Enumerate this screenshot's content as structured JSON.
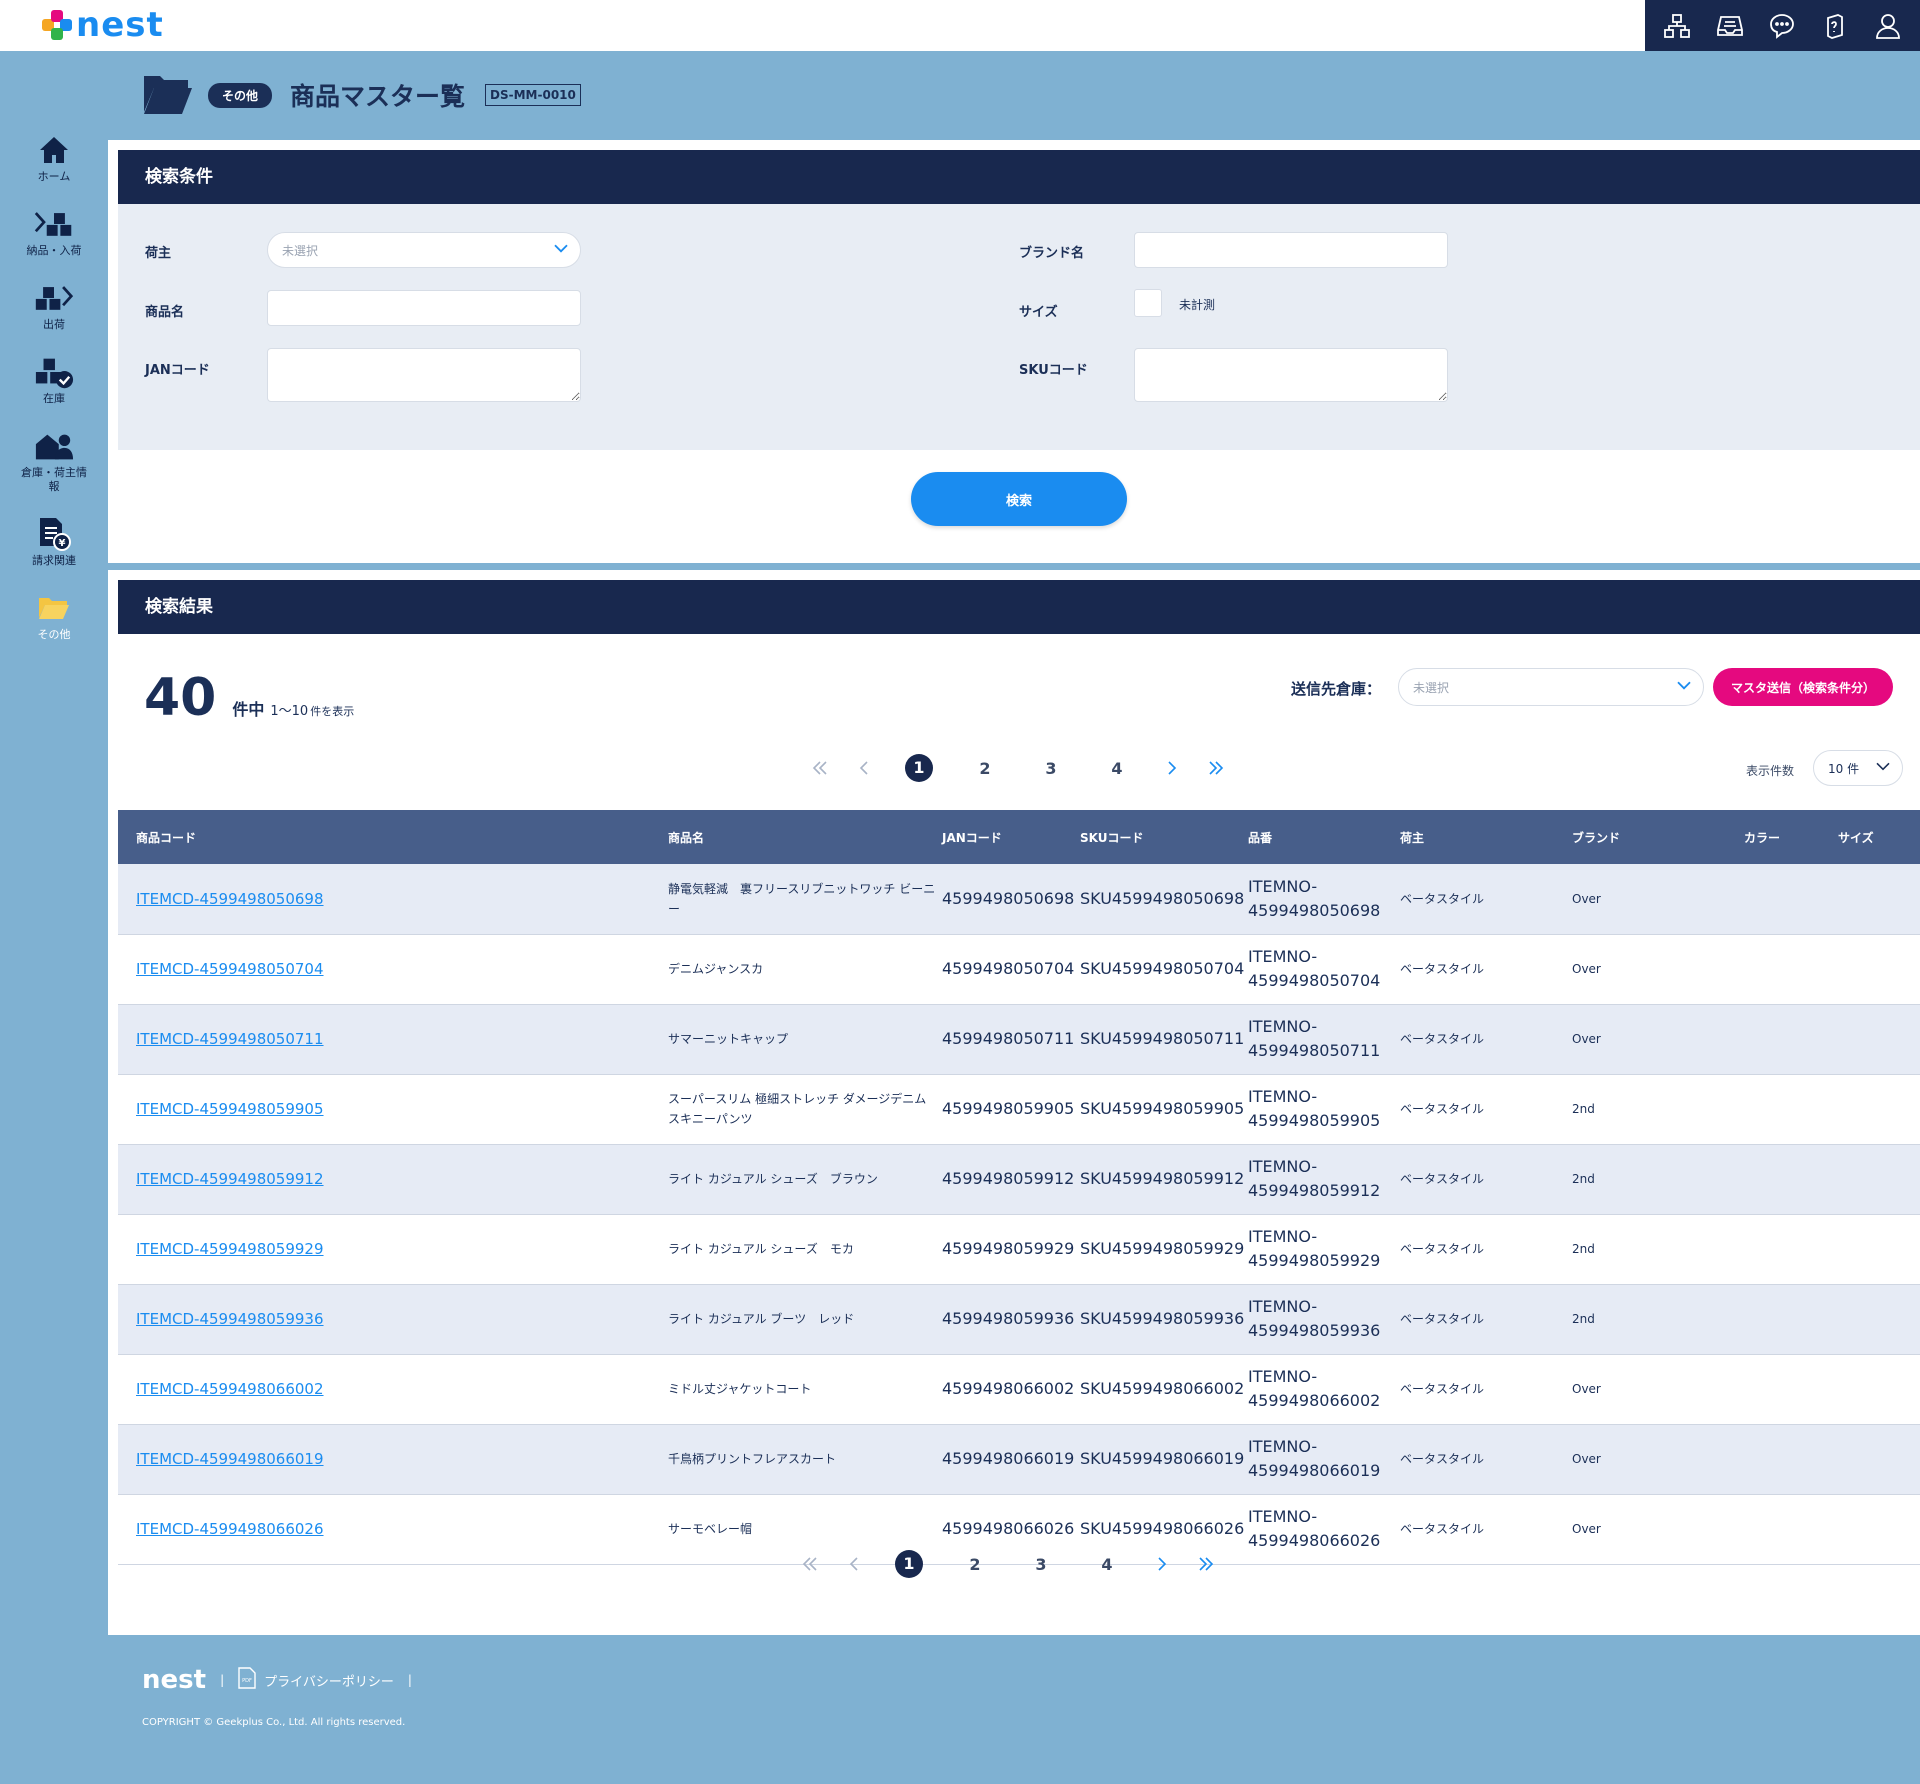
{
  "app": {
    "logo": "nest"
  },
  "page": {
    "category": "その他",
    "title": "商品マスター覧",
    "code": "DS-MM-0010"
  },
  "sidebar": {
    "items": [
      {
        "label": "ホーム",
        "icon": "home-icon"
      },
      {
        "label": "納品・入荷",
        "icon": "inbound-icon"
      },
      {
        "label": "出荷",
        "icon": "outbound-icon"
      },
      {
        "label": "在庫",
        "icon": "stock-icon"
      },
      {
        "label": "倉庫・荷主情報",
        "icon": "warehouse-icon"
      },
      {
        "label": "請求関連",
        "icon": "billing-icon"
      },
      {
        "label": "その他",
        "icon": "folder-icon"
      }
    ]
  },
  "search": {
    "title": "検索条件",
    "shipper_label": "荷主",
    "shipper_placeholder": "未選択",
    "product_name_label": "商品名",
    "jan_label": "JANコード",
    "brand_label": "ブランド名",
    "size_label": "サイズ",
    "unmeasured_label": "未計測",
    "sku_label": "SKUコード",
    "button": "検索"
  },
  "results": {
    "title": "検索結果",
    "total": "40",
    "unit": "件中",
    "range": "1～10",
    "range_suffix": "件を表示",
    "dest_label": "送信先倉庫：",
    "dest_placeholder": "未選択",
    "master_send": "マスタ送信（検索条件分）",
    "per_page_label": "表示件数",
    "per_page": "10 件",
    "pages": [
      "1",
      "2",
      "3",
      "4"
    ],
    "columns": [
      "商品コード",
      "商品名",
      "JANコード",
      "SKUコード",
      "品番",
      "荷主",
      "ブランド",
      "カラー",
      "サイズ"
    ],
    "rows": [
      {
        "code": "ITEMCD-4599498050698",
        "name": "静電気軽減　裏フリースリブニットワッチ ビーニー",
        "jan": "4599498050698",
        "sku": "SKU4599498050698",
        "item1": "ITEMNO-",
        "item2": "4599498050698",
        "owner": "ベータスタイル",
        "brand": "Over",
        "color": "",
        "size": ""
      },
      {
        "code": "ITEMCD-4599498050704",
        "name": "デニムジャンスカ",
        "jan": "4599498050704",
        "sku": "SKU4599498050704",
        "item1": "ITEMNO-",
        "item2": "4599498050704",
        "owner": "ベータスタイル",
        "brand": "Over",
        "color": "",
        "size": ""
      },
      {
        "code": "ITEMCD-4599498050711",
        "name": "サマーニットキャップ",
        "jan": "4599498050711",
        "sku": "SKU4599498050711",
        "item1": "ITEMNO-",
        "item2": "4599498050711",
        "owner": "ベータスタイル",
        "brand": "Over",
        "color": "",
        "size": ""
      },
      {
        "code": "ITEMCD-4599498059905",
        "name": "スーパースリム 極細ストレッチ ダメージデニムスキニーパンツ",
        "jan": "4599498059905",
        "sku": "SKU4599498059905",
        "item1": "ITEMNO-",
        "item2": "4599498059905",
        "owner": "ベータスタイル",
        "brand": "2nd",
        "color": "",
        "size": ""
      },
      {
        "code": "ITEMCD-4599498059912",
        "name": "ライト カジュアル シューズ　ブラウン",
        "jan": "4599498059912",
        "sku": "SKU4599498059912",
        "item1": "ITEMNO-",
        "item2": "4599498059912",
        "owner": "ベータスタイル",
        "brand": "2nd",
        "color": "",
        "size": ""
      },
      {
        "code": "ITEMCD-4599498059929",
        "name": "ライト カジュアル シューズ　モカ",
        "jan": "4599498059929",
        "sku": "SKU4599498059929",
        "item1": "ITEMNO-",
        "item2": "4599498059929",
        "owner": "ベータスタイル",
        "brand": "2nd",
        "color": "",
        "size": ""
      },
      {
        "code": "ITEMCD-4599498059936",
        "name": "ライト カジュアル ブーツ　レッド",
        "jan": "4599498059936",
        "sku": "SKU4599498059936",
        "item1": "ITEMNO-",
        "item2": "4599498059936",
        "owner": "ベータスタイル",
        "brand": "2nd",
        "color": "",
        "size": ""
      },
      {
        "code": "ITEMCD-4599498066002",
        "name": "ミドル丈ジャケットコート",
        "jan": "4599498066002",
        "sku": "SKU4599498066002",
        "item1": "ITEMNO-",
        "item2": "4599498066002",
        "owner": "ベータスタイル",
        "brand": "Over",
        "color": "",
        "size": ""
      },
      {
        "code": "ITEMCD-4599498066019",
        "name": "千鳥柄プリントフレアスカート",
        "jan": "4599498066019",
        "sku": "SKU4599498066019",
        "item1": "ITEMNO-",
        "item2": "4599498066019",
        "owner": "ベータスタイル",
        "brand": "Over",
        "color": "",
        "size": ""
      },
      {
        "code": "ITEMCD-4599498066026",
        "name": "サーモベレー帽",
        "jan": "4599498066026",
        "sku": "SKU4599498066026",
        "item1": "ITEMNO-",
        "item2": "4599498066026",
        "owner": "ベータスタイル",
        "brand": "Over",
        "color": "",
        "size": ""
      }
    ]
  },
  "footer": {
    "logo": "nest",
    "privacy": "プライバシーポリシー",
    "copyright": "COPYRIGHT © Geekplus Co., Ltd. All rights reserved."
  },
  "colors": {
    "navy": "#18284e",
    "accent_blue": "#1a8cf0",
    "magenta": "#e5097f",
    "background": "#7fb1d2",
    "table_header": "#475e8a"
  }
}
